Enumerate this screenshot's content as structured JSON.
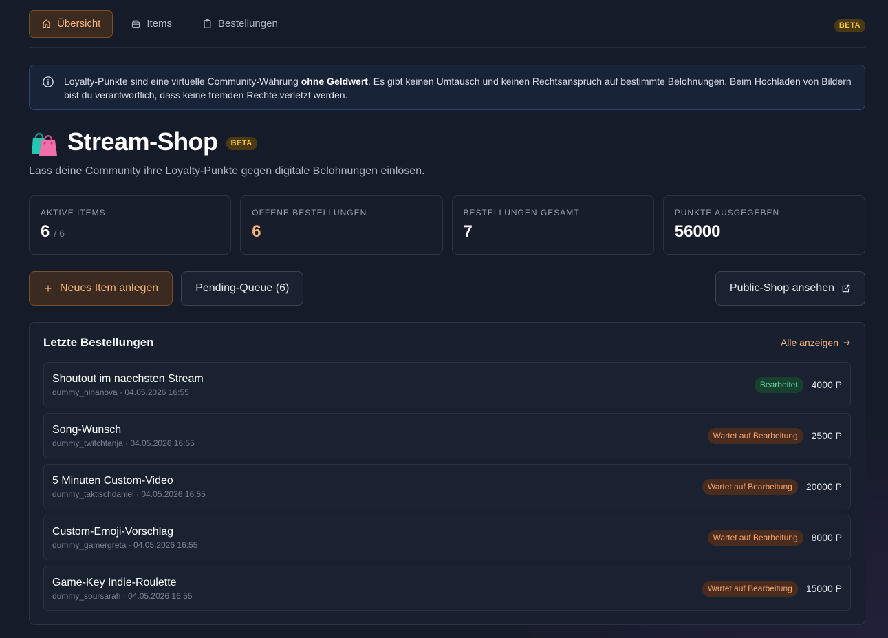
{
  "nav": {
    "tabs": [
      {
        "label": "Übersicht",
        "icon": "home-icon"
      },
      {
        "label": "Items",
        "icon": "box-icon"
      },
      {
        "label": "Bestellungen",
        "icon": "clipboard-icon"
      }
    ],
    "beta": "BETA"
  },
  "info": {
    "text_before": "Loyalty-Punkte sind eine virtuelle Community-Währung ",
    "text_bold": "ohne Geldwert",
    "text_after": ". Es gibt keinen Umtausch und keinen Rechtsanspruch auf bestimmte Belohnungen. Beim Hochladen von Bildern bist du verantwortlich, dass keine fremden Rechte verletzt werden."
  },
  "header": {
    "title": "Stream-Shop",
    "beta": "BETA",
    "subtitle": "Lass deine Community ihre Loyalty-Punkte gegen digitale Belohnungen einlösen."
  },
  "stats": [
    {
      "label": "AKTIVE ITEMS",
      "value": "6",
      "sub": "/ 6"
    },
    {
      "label": "OFFENE BESTELLUNGEN",
      "value": "6"
    },
    {
      "label": "BESTELLUNGEN GESAMT",
      "value": "7"
    },
    {
      "label": "PUNKTE AUSGEGEBEN",
      "value": "56000"
    }
  ],
  "actions": {
    "new_item": "Neues Item anlegen",
    "pending_queue": "Pending-Queue (6)",
    "public_shop": "Public-Shop ansehen"
  },
  "orders": {
    "title": "Letzte Bestellungen",
    "view_all": "Alle anzeigen",
    "items": [
      {
        "name": "Shoutout im naechsten Stream",
        "meta": "dummy_ninanova · 04.05.2026 16:55",
        "status": "Bearbeitet",
        "points": "4000 P"
      },
      {
        "name": "Song-Wunsch",
        "meta": "dummy_twitchtanja · 04.05.2026 16:55",
        "status": "Wartet auf Bearbeitung",
        "points": "2500 P"
      },
      {
        "name": "5 Minuten Custom-Video",
        "meta": "dummy_taktischdaniel · 04.05.2026 16:55",
        "status": "Wartet auf Bearbeitung",
        "points": "20000 P"
      },
      {
        "name": "Custom-Emoji-Vorschlag",
        "meta": "dummy_gamergreta · 04.05.2026 16:55",
        "status": "Wartet auf Bearbeitung",
        "points": "8000 P"
      },
      {
        "name": "Game-Key Indie-Roulette",
        "meta": "dummy_soursarah · 04.05.2026 16:55",
        "status": "Wartet auf Bearbeitung",
        "points": "15000 P"
      }
    ]
  },
  "colors": {
    "accent": "#f6b37a",
    "background": "#151b28",
    "status_done": "#5fd8a0",
    "status_wait": "#f5a66e",
    "beta": "#f2c23c"
  }
}
